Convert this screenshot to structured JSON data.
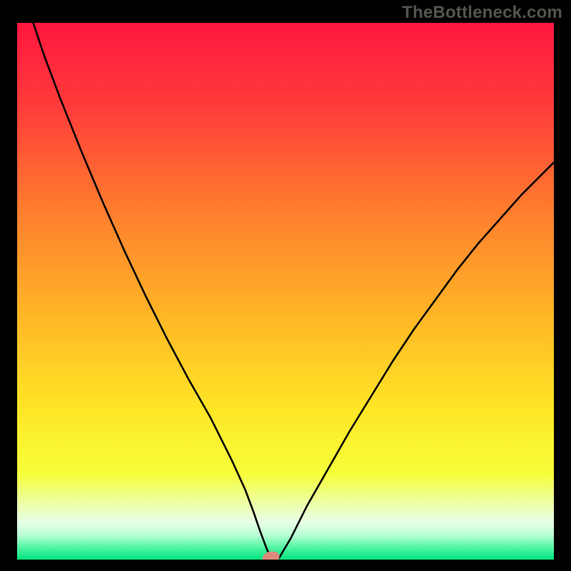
{
  "watermark": "TheBottleneck.com",
  "chart_data": {
    "type": "line",
    "title": "",
    "xlabel": "",
    "ylabel": "",
    "xlim": [
      0,
      100
    ],
    "ylim": [
      0,
      100
    ],
    "grid": false,
    "legend": false,
    "background": {
      "style": "vertical-gradient",
      "stops": [
        {
          "pos": 0.0,
          "color": "#ff173f"
        },
        {
          "pos": 0.15,
          "color": "#ff3a3a"
        },
        {
          "pos": 0.35,
          "color": "#ff7d2e"
        },
        {
          "pos": 0.55,
          "color": "#ffb726"
        },
        {
          "pos": 0.72,
          "color": "#ffe626"
        },
        {
          "pos": 0.84,
          "color": "#f6ff3a"
        },
        {
          "pos": 0.9,
          "color": "#ecffb0"
        },
        {
          "pos": 0.93,
          "color": "#e8ffe8"
        },
        {
          "pos": 0.955,
          "color": "#b8ffd4"
        },
        {
          "pos": 0.975,
          "color": "#5cf7a7"
        },
        {
          "pos": 1.0,
          "color": "#00e47e"
        }
      ]
    },
    "series": [
      {
        "name": "bottleneck-curve",
        "color": "#000000",
        "x": [
          3,
          5,
          8,
          12,
          16,
          20,
          24,
          28,
          32,
          36,
          40,
          42.5,
          44,
          45.2,
          46.5,
          47.3,
          48.8,
          51,
          54,
          58,
          62,
          66,
          70,
          74,
          78,
          82,
          86,
          90,
          94,
          98,
          100
        ],
        "y": [
          100,
          94,
          86,
          76,
          66.5,
          57.5,
          49,
          41,
          33.5,
          26.5,
          18.5,
          13,
          9,
          5.5,
          2,
          0.3,
          0.3,
          4,
          10,
          17,
          24,
          30.5,
          37,
          43,
          48.5,
          54,
          59,
          63.5,
          68,
          72,
          74
        ]
      }
    ],
    "marker": {
      "name": "inflection-marker",
      "x": 47.3,
      "y": 0.0,
      "color": "#dd8a7c",
      "rx": 1.6,
      "ry": 1.1,
      "angle": -12
    }
  }
}
